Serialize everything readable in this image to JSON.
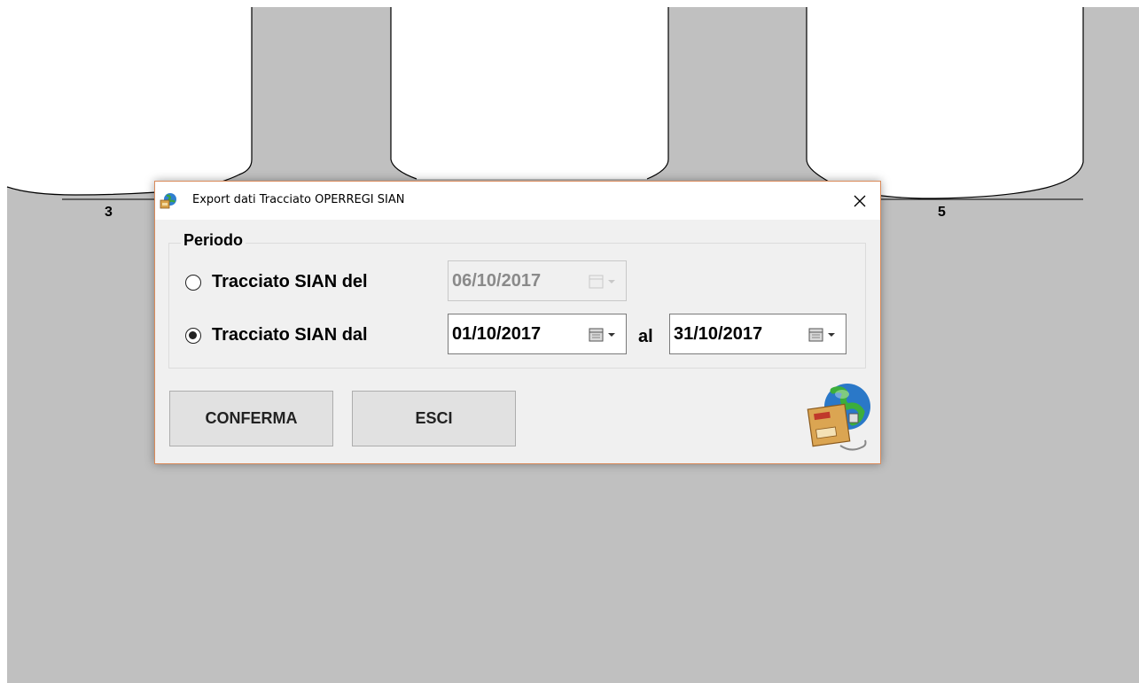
{
  "background": {
    "tab_numbers": [
      "3",
      "5"
    ]
  },
  "dialog": {
    "title": "Export dati Tracciato OPERREGI SIAN",
    "close_symbol": "✕",
    "group_title": "Periodo",
    "option_single": {
      "label": "Tracciato SIAN del",
      "checked": false,
      "date": "06/10/2017",
      "enabled": false
    },
    "option_range": {
      "label": "Tracciato SIAN dal",
      "checked": true,
      "date_from": "01/10/2017",
      "separator": "al",
      "date_to": "31/10/2017"
    },
    "buttons": {
      "confirm": "CONFERMA",
      "exit": "ESCI"
    },
    "corner_icon": "export-package-globe-icon",
    "title_icon": "app-globe-icon",
    "calendar_icon": "calendar-dropdown-icon"
  },
  "colors": {
    "backdrop_gray": "#c0c0c0",
    "dialog_border": "#d98a5a",
    "dialog_bg": "#f0f0f0",
    "button_bg": "#e1e1e1"
  }
}
